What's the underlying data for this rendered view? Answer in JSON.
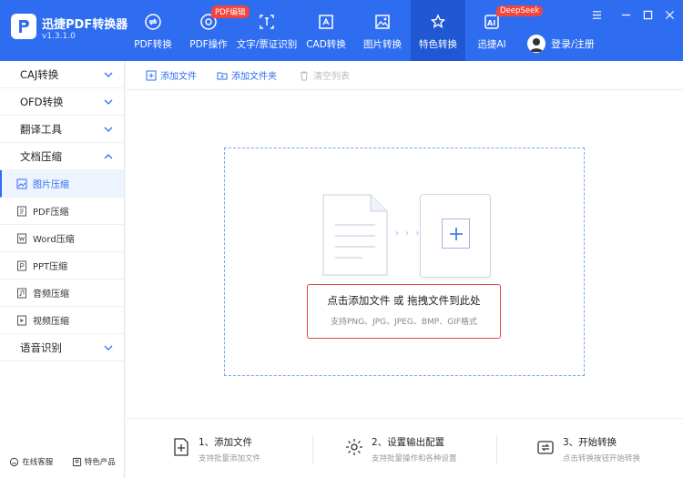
{
  "app": {
    "title": "迅捷PDF转换器",
    "version": "v1.3.1.0"
  },
  "nav": [
    {
      "label": "PDF转换",
      "icon": "convert-icon"
    },
    {
      "label": "PDF操作",
      "icon": "pdf-edit-icon",
      "badge": "PDF编辑"
    },
    {
      "label": "文字/票证识别",
      "icon": "ocr-icon"
    },
    {
      "label": "CAD转换",
      "icon": "cad-icon"
    },
    {
      "label": "图片转换",
      "icon": "image-icon"
    },
    {
      "label": "特色转换",
      "icon": "star-convert-icon",
      "active": true
    },
    {
      "label": "迅捷AI",
      "icon": "ai-icon",
      "badge": "DeepSeek"
    }
  ],
  "login_label": "登录/注册",
  "sidebar": {
    "categories": [
      {
        "label": "CAJ转换"
      },
      {
        "label": "OFD转换"
      },
      {
        "label": "翻译工具"
      },
      {
        "label": "文档压缩",
        "expanded": true
      }
    ],
    "sub_items": [
      {
        "label": "图片压缩",
        "active": true
      },
      {
        "label": "PDF压缩"
      },
      {
        "label": "Word压缩"
      },
      {
        "label": "PPT压缩"
      },
      {
        "label": "音频压缩"
      },
      {
        "label": "视频压缩"
      }
    ],
    "last_category": {
      "label": "语音识别"
    },
    "footer": {
      "support": "在线客服",
      "features": "特色产品"
    }
  },
  "toolbar": {
    "add_file": "添加文件",
    "add_folder": "添加文件夹",
    "clear_list": "清空列表"
  },
  "dropzone": {
    "main_prefix": "点击添加文件",
    "main_or": "或",
    "main_suffix": "拖拽文件到此处",
    "arrows": "› › ›",
    "sub": "支持PNG、JPG、JPEG、BMP、GIF格式"
  },
  "steps": [
    {
      "title": "1、添加文件",
      "desc": "支持批量添加文件"
    },
    {
      "title": "2、设置输出配置",
      "desc": "支持批量操作和各种设置"
    },
    {
      "title": "3、开始转换",
      "desc": "点击转换按钮开始转换"
    }
  ],
  "colors": {
    "brand": "#2f6df0",
    "badge": "#f1453d",
    "highlight_border": "#e0473f"
  }
}
